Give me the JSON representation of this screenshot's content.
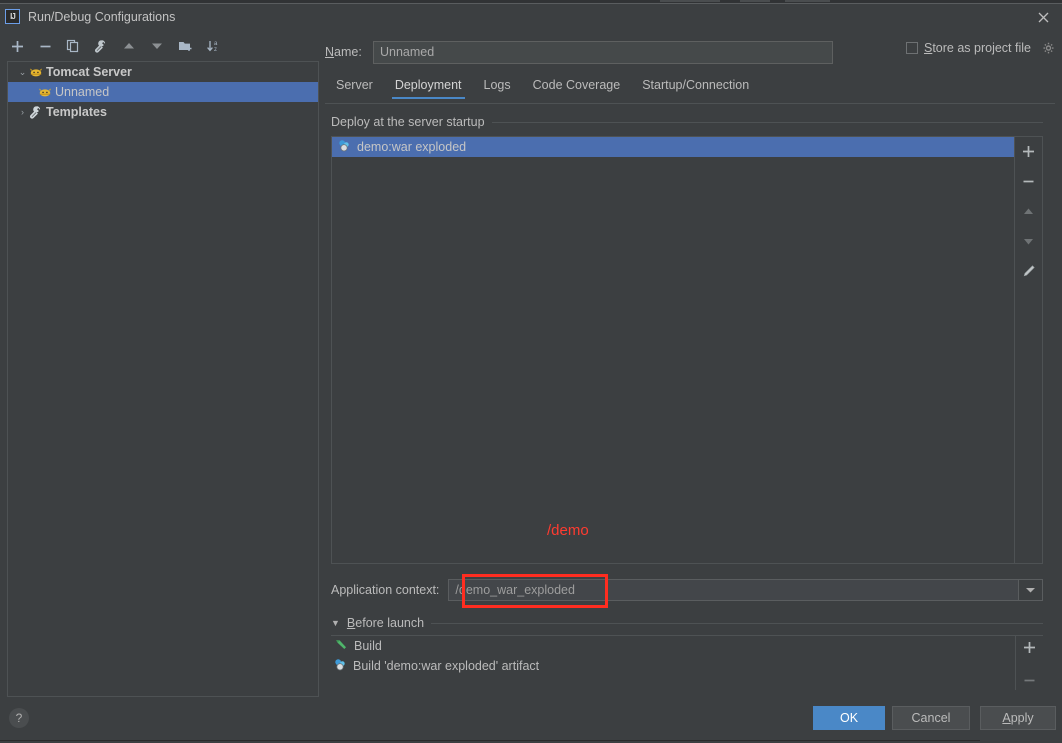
{
  "window": {
    "title": "Run/Debug Configurations",
    "app_icon": "intellij-idea-icon",
    "close_icon": "close-icon"
  },
  "toolbar": {
    "buttons": [
      {
        "name": "add-configuration-button",
        "icon": "plus-icon",
        "glyph": "+"
      },
      {
        "name": "remove-configuration-button",
        "icon": "minus-icon",
        "glyph": "−"
      },
      {
        "name": "copy-configuration-button",
        "icon": "copy-icon",
        "glyph": "❐"
      },
      {
        "name": "edit-templates-button",
        "icon": "wrench-icon",
        "glyph": "🔧"
      },
      {
        "name": "move-up-button",
        "icon": "arrow-up-icon",
        "glyph": "▲"
      },
      {
        "name": "move-down-button",
        "icon": "arrow-down-icon",
        "glyph": "▼"
      },
      {
        "name": "move-into-folder-button",
        "icon": "folder-add-icon",
        "glyph": "◰"
      },
      {
        "name": "sort-configurations-button",
        "icon": "sort-az-icon",
        "glyph": "⇩"
      }
    ]
  },
  "tree": {
    "nodes": [
      {
        "label": "Tomcat Server",
        "icon": "tomcat-icon",
        "expander": "⌄",
        "level": 0,
        "bold": true,
        "selected": false
      },
      {
        "label": "Unnamed",
        "icon": "tomcat-icon",
        "expander": "",
        "level": 1,
        "bold": false,
        "selected": true
      },
      {
        "label": "Templates",
        "icon": "wrench-icon",
        "expander": "›",
        "level": 0,
        "bold": true,
        "selected": false
      }
    ]
  },
  "name_field": {
    "label": "Name:",
    "label_mnemonic": "N",
    "label_rest": "ame:",
    "value": "Unnamed",
    "placeholder": "Unnamed"
  },
  "store_as_project_file": {
    "label_mnemonic": "S",
    "label_rest": "tore as project file",
    "checked": false,
    "gear_icon": "gear-icon"
  },
  "tabs": [
    {
      "label": "Server",
      "active": false
    },
    {
      "label": "Deployment",
      "active": true
    },
    {
      "label": "Logs",
      "active": false
    },
    {
      "label": "Code Coverage",
      "active": false
    },
    {
      "label": "Startup/Connection",
      "active": false
    }
  ],
  "deployment": {
    "group_title": "Deploy at the server startup",
    "items": [
      {
        "label": "demo:war exploded",
        "icon": "artifact-icon",
        "selected": true
      }
    ],
    "side_buttons": [
      {
        "name": "add-artifact-button",
        "icon": "plus-icon",
        "glyph": "+",
        "enabled": true
      },
      {
        "name": "remove-artifact-button",
        "icon": "minus-icon",
        "glyph": "−",
        "enabled": true
      },
      {
        "name": "move-artifact-up-button",
        "icon": "arrow-up-icon",
        "glyph": "▲",
        "enabled": false
      },
      {
        "name": "move-artifact-down-button",
        "icon": "arrow-down-icon",
        "glyph": "▼",
        "enabled": false
      },
      {
        "name": "edit-artifact-button",
        "icon": "pencil-icon",
        "glyph": "✎",
        "enabled": true
      }
    ],
    "annotation": {
      "text": "/demo",
      "color": "#ff3b30"
    }
  },
  "application_context": {
    "label": "Application context:",
    "value": "/demo_war_exploded",
    "placeholder": "/demo_war_exploded",
    "dropdown_icon": "chevron-down-icon",
    "highlight_color": "#ff2d20"
  },
  "before_launch": {
    "caret": "▼",
    "title_mnemonic": "B",
    "title_rest": "efore launch",
    "items": [
      {
        "label": "Build",
        "icon": "build-hammer-icon"
      },
      {
        "label": "Build 'demo:war exploded' artifact",
        "icon": "artifact-icon"
      }
    ],
    "side_buttons": [
      {
        "name": "add-before-launch-task-button",
        "icon": "plus-icon",
        "glyph": "+",
        "enabled": true
      },
      {
        "name": "remove-before-launch-task-button",
        "icon": "minus-icon",
        "glyph": "−",
        "enabled": false
      }
    ]
  },
  "footer": {
    "help_label": "?",
    "ok_label": "OK",
    "cancel_label": "Cancel",
    "apply_mnemonic": "A",
    "apply_rest": "pply"
  },
  "colors": {
    "background": "#3c3f41",
    "selection": "#4b6eaf",
    "accent": "#4a88c7",
    "annotation": "#ff3b30"
  }
}
